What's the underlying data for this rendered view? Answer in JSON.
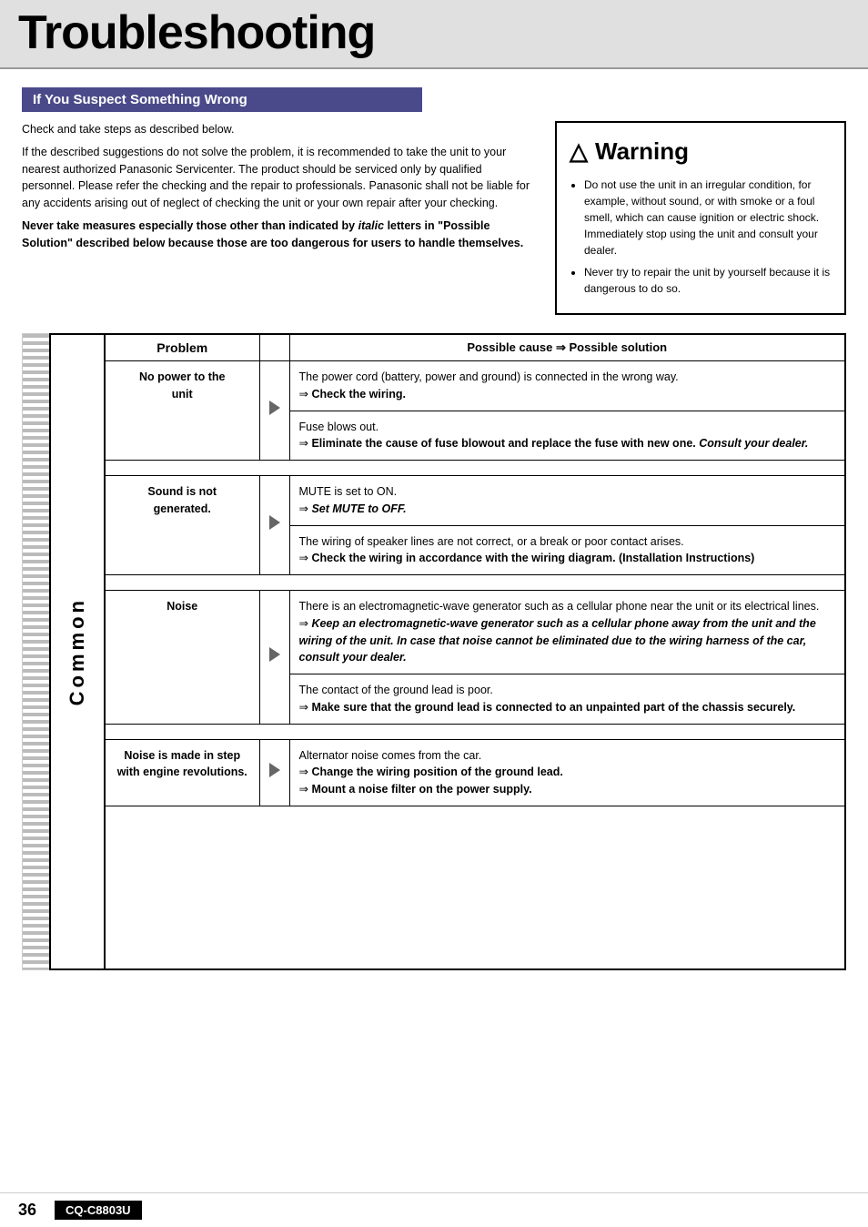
{
  "header": {
    "title": "Troubleshooting"
  },
  "section": {
    "heading": "If You Suspect Something Wrong"
  },
  "intro": {
    "line1": "Check and take steps as described below.",
    "line2": "If the described suggestions do not solve the problem, it is recommended to take the unit to your nearest authorized Panasonic Servicenter. The product should be serviced only by qualified personnel. Please refer the checking and the repair to professionals. Panasonic shall not be liable for any accidents arising out of neglect of checking the unit or your own repair after your checking.",
    "bold_warning": "Never take measures especially those other than indicated by italic letters in “Possible Solution” described below because those are too dangerous for users to handle themselves."
  },
  "warning": {
    "title": "Warning",
    "icon": "⚠",
    "items": [
      "Do not use the unit in an irregular condition, for example, without sound, or with smoke or a foul smell, which can cause ignition or electric shock. Immediately stop using the unit and consult your dealer.",
      "Never try to repair the unit by yourself because it is dangerous to do so."
    ]
  },
  "table": {
    "header_problem": "Problem",
    "header_cause": "Possible cause",
    "header_arrow": "⇒",
    "header_solution": "Possible solution",
    "common_label": "Common",
    "rows": [
      {
        "problem": "No power to the unit",
        "solutions": [
          {
            "cause": "The power cord (battery, power and ground) is connected in the wrong way.",
            "solution": "Check the wiring."
          },
          {
            "cause": "Fuse blows out.",
            "solution": "Eliminate the cause of fuse blowout and replace the fuse with new one. Consult your dealer.",
            "solution_italic": true
          }
        ]
      },
      {
        "problem": "Sound is not generated.",
        "solutions": [
          {
            "cause": "MUTE is set to ON.",
            "solution": "Set MUTE to OFF.",
            "solution_italic": true
          },
          {
            "cause": "The wiring of speaker lines are not correct, or a break or poor contact arises.",
            "solution": "Check the wiring in accordance with the wiring diagram. (Installation Instructions)"
          }
        ]
      },
      {
        "problem": "Noise",
        "solutions": [
          {
            "cause": "There is an electromagnetic-wave generator such as a cellular phone near the unit or its electrical lines.",
            "solution": "Keep an electromagnetic-wave generator such as a cellular phone away from the unit and the wiring of the unit. In case that noise cannot be eliminated due to the wiring harness of the car, consult your dealer.",
            "solution_italic": true
          },
          {
            "cause": "The contact of the ground lead is poor.",
            "solution": "Make sure that the ground lead is connected to an unpainted part of the chassis securely."
          }
        ]
      },
      {
        "problem": "Noise is made in step with engine revolutions.",
        "solutions": [
          {
            "cause": "Alternator noise comes from the car.",
            "solution_lines": [
              "Change the wiring position of the ground lead.",
              "Mount a noise filter on the power supply."
            ]
          }
        ]
      }
    ]
  },
  "footer": {
    "page_number": "36",
    "model": "CQ-C8803U"
  }
}
